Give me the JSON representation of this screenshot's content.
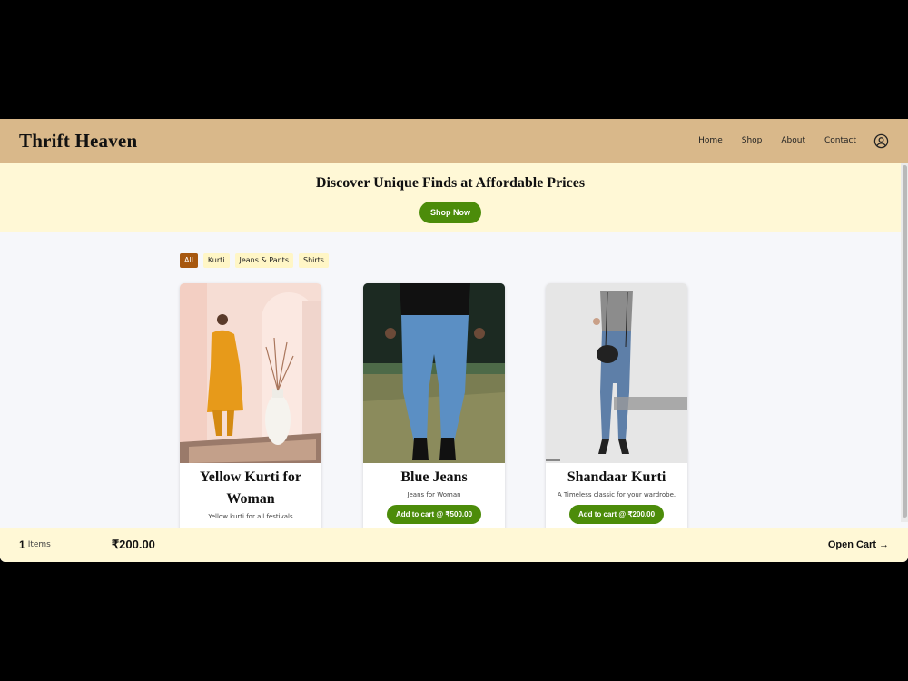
{
  "header": {
    "brand": "Thrift Heaven",
    "nav": [
      "Home",
      "Shop",
      "About",
      "Contact"
    ],
    "user_icon": "user-circle-icon"
  },
  "hero": {
    "title": "Discover Unique Finds at Affordable Prices",
    "button": "Shop Now"
  },
  "filters": [
    "All",
    "Kurti",
    "Jeans & Pants",
    "Shirts"
  ],
  "active_filter": "All",
  "products": [
    {
      "title": "Yellow Kurti for Woman",
      "description": "Yellow kurti for all festivals",
      "button": ""
    },
    {
      "title": "Blue Jeans",
      "description": "Jeans for Woman",
      "button": "Add to cart @ ₹500.00"
    },
    {
      "title": "Shandaar Kurti",
      "description": "A Timeless classic for your wardrobe.",
      "button": "Add to cart @ ₹200.00"
    }
  ],
  "cart": {
    "count": "1",
    "count_label": "Items",
    "total": "₹200.00",
    "open_label": "Open Cart",
    "arrow": "→"
  },
  "colors": {
    "header_bg": "#d9b88a",
    "hero_bg": "#fff8d6",
    "accent_green": "#4c8c0a",
    "active_chip": "#a7580f"
  }
}
